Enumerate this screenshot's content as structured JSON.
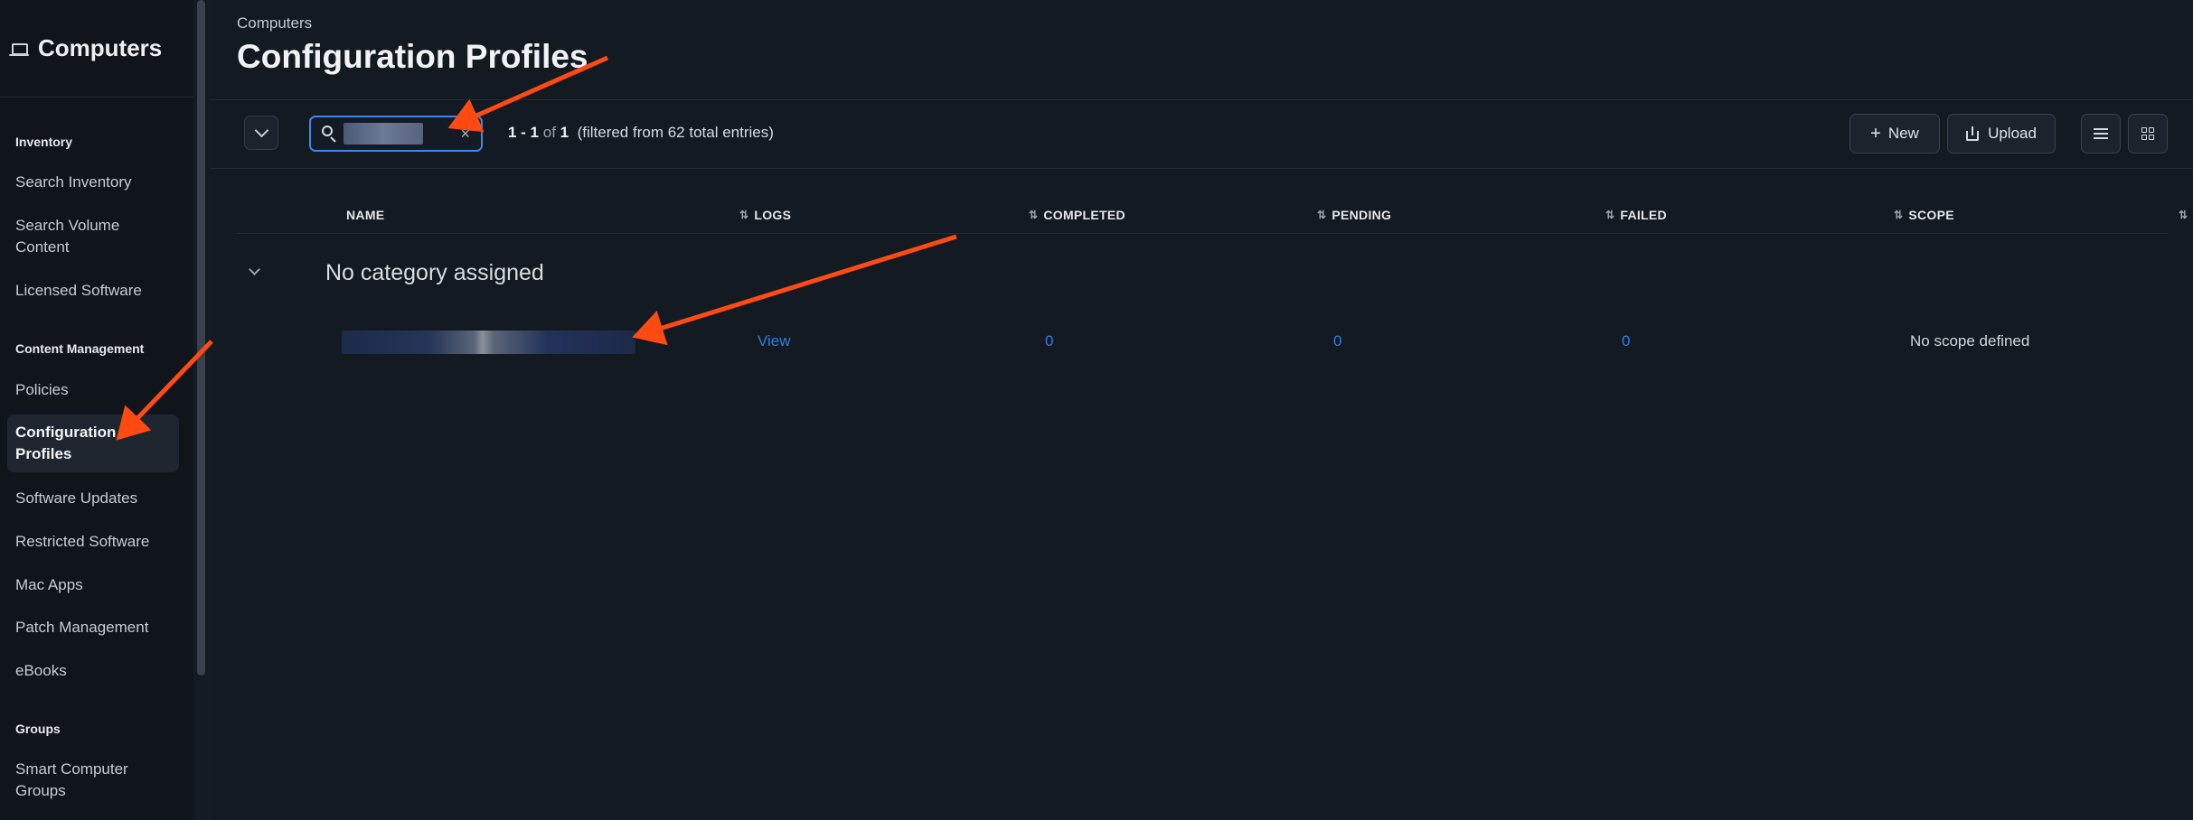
{
  "sidebar": {
    "title": "Computers",
    "sections": [
      {
        "heading": "Inventory",
        "items": [
          {
            "label": "Search Inventory"
          },
          {
            "label": "Search Volume Content"
          },
          {
            "label": "Licensed Software"
          }
        ]
      },
      {
        "heading": "Content Management",
        "items": [
          {
            "label": "Policies"
          },
          {
            "label": "Configuration Profiles",
            "active": true
          },
          {
            "label": "Software Updates"
          },
          {
            "label": "Restricted Software"
          },
          {
            "label": "Mac Apps"
          },
          {
            "label": "Patch Management"
          },
          {
            "label": "eBooks"
          }
        ]
      },
      {
        "heading": "Groups",
        "items": [
          {
            "label": "Smart Computer Groups"
          }
        ]
      }
    ]
  },
  "header": {
    "breadcrumb": "Computers",
    "title": "Configuration Profiles"
  },
  "toolbar": {
    "search_value": "",
    "clear_glyph": "×",
    "pager_range": "1 - 1",
    "pager_of": " of ",
    "pager_total": "1",
    "pager_filter": "(filtered from 62 total entries)",
    "new_label": "New",
    "upload_label": "Upload"
  },
  "table": {
    "columns": {
      "name": "NAME",
      "logs": "LOGS",
      "completed": "COMPLETED",
      "pending": "PENDING",
      "failed": "FAILED",
      "scope": "SCOPE"
    },
    "group_label": "No category assigned",
    "rows": [
      {
        "logs": "View",
        "completed": "0",
        "pending": "0",
        "failed": "0",
        "scope": "No scope defined"
      }
    ]
  },
  "colors": {
    "accent": "#3f86e8",
    "link": "#2f7de1",
    "annotation_arrow": "#ff4a12",
    "background": "#141a22",
    "sidebar_background": "#10151c"
  },
  "icons": [
    "computer-icon",
    "chevron-down-icon",
    "search-icon",
    "close-icon",
    "plus-icon",
    "upload-icon",
    "list-view-icon",
    "grid-view-icon",
    "sort-icon"
  ]
}
